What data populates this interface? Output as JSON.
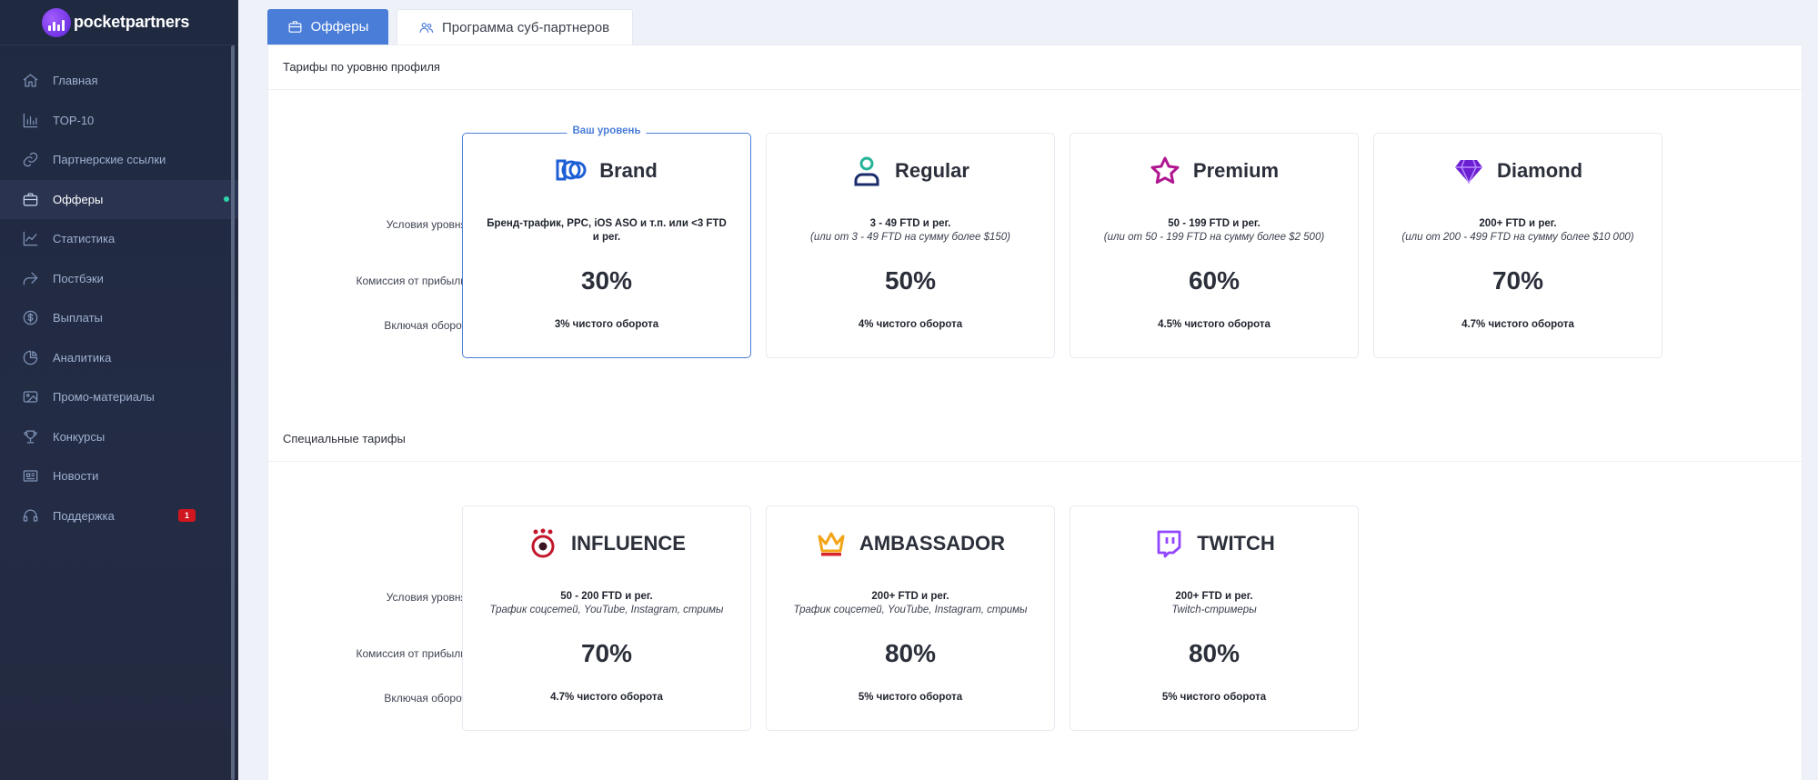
{
  "brand": {
    "name": "pocketpartners"
  },
  "sidebar": {
    "items": [
      {
        "label": "Главная",
        "icon": "home-icon"
      },
      {
        "label": "TOP-10",
        "icon": "bar-chart-icon"
      },
      {
        "label": "Партнерские ссылки",
        "icon": "link-icon"
      },
      {
        "label": "Офферы",
        "icon": "briefcase-icon",
        "active": true
      },
      {
        "label": "Статистика",
        "icon": "trend-icon"
      },
      {
        "label": "Постбэки",
        "icon": "share-icon"
      },
      {
        "label": "Выплаты",
        "icon": "dollar-coin-icon"
      },
      {
        "label": "Аналитика",
        "icon": "pie-chart-icon"
      },
      {
        "label": "Промо-материалы",
        "icon": "image-icon"
      },
      {
        "label": "Конкурсы",
        "icon": "trophy-icon"
      },
      {
        "label": "Новости",
        "icon": "newspaper-icon"
      },
      {
        "label": "Поддержка",
        "icon": "headset-icon",
        "badge": "1"
      }
    ]
  },
  "tabs": [
    {
      "label": "Офферы",
      "icon": "briefcase-icon",
      "active": true
    },
    {
      "label": "Программа суб-партнеров",
      "icon": "users-icon",
      "active": false
    }
  ],
  "profile_section": {
    "title": "Тарифы по уровню профиля",
    "row_labels": {
      "conditions": "Условия уровня",
      "commission": "Комиссия от прибыли",
      "turnover": "Включая оборот"
    },
    "current_tag": "Ваш уровень",
    "cards": [
      {
        "name": "Brand",
        "icon": "brand-logo-icon",
        "cond_bold": "Бренд-трафик, PPC, iOS ASO и т.п. или <3 FTD и рег.",
        "cond_italic": "",
        "pct": "30%",
        "turnover": "3% чистого оборота"
      },
      {
        "name": "Regular",
        "icon": "user-icon",
        "cond_bold": "3 - 49 FTD и рег.",
        "cond_italic": "(или от 3 - 49 FTD на сумму более $150)",
        "pct": "50%",
        "turnover": "4% чистого оборота"
      },
      {
        "name": "Premium",
        "icon": "star-icon",
        "cond_bold": "50 - 199 FTD и рег.",
        "cond_italic": "(или от 50 - 199 FTD на сумму более $2 500)",
        "pct": "60%",
        "turnover": "4.5% чистого оборота"
      },
      {
        "name": "Diamond",
        "icon": "diamond-icon",
        "cond_bold": "200+ FTD и рег.",
        "cond_italic": "(или от 200 - 499 FTD на сумму более $10 000)",
        "pct": "70%",
        "turnover": "4.7% чистого оборота"
      }
    ]
  },
  "special_section": {
    "title": "Специальные тарифы",
    "row_labels": {
      "conditions": "Условия уровня",
      "commission": "Комиссия от прибыли",
      "turnover": "Включая оборот"
    },
    "cards": [
      {
        "name": "INFLUENCE",
        "icon": "influence-icon",
        "cond_bold": "50 - 200 FTD и рег.",
        "cond_italic": "Трафик соцсетей, YouTube, Instagram, стримы",
        "pct": "70%",
        "turnover": "4.7% чистого оборота"
      },
      {
        "name": "AMBASSADOR",
        "icon": "crown-icon",
        "cond_bold": "200+ FTD и рег.",
        "cond_italic": "Трафик соцсетей, YouTube, Instagram, стримы",
        "pct": "80%",
        "turnover": "5% чистого оборота"
      },
      {
        "name": "TWITCH",
        "icon": "twitch-icon",
        "cond_bold": "200+ FTD и рег.",
        "cond_italic": "Twitch-стримеры",
        "pct": "80%",
        "turnover": "5% чистого оборота"
      }
    ]
  }
}
